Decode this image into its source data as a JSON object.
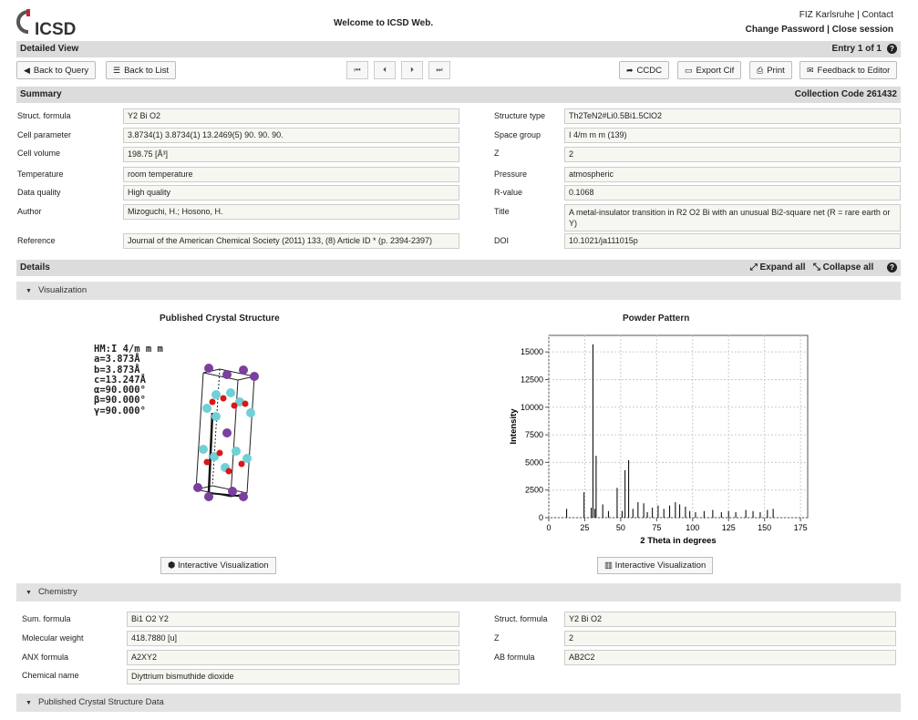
{
  "header": {
    "logo_text": "ICSD",
    "welcome": "Welcome to ICSD Web.",
    "fiz": "FIZ Karlsruhe",
    "contact": "Contact",
    "change_password": "Change Password",
    "close_session": "Close session"
  },
  "detailed_view": {
    "title": "Detailed View",
    "entry": "Entry 1 of 1"
  },
  "toolbar": {
    "back_query": "Back to Query",
    "back_list": "Back to List",
    "ccdc": "CCDC",
    "export_cif": "Export Cif",
    "print": "Print",
    "feedback": "Feedback to Editor"
  },
  "summary": {
    "title": "Summary",
    "collection": "Collection Code 261432",
    "left": [
      {
        "label": "Struct. formula",
        "value": "Y2 Bi O2"
      },
      {
        "label": "Cell parameter",
        "value": "3.8734(1) 3.8734(1) 13.2469(5) 90. 90. 90."
      },
      {
        "label": "Cell volume",
        "value": "198.75 [Å³]"
      },
      {
        "label": "Temperature",
        "value": "room temperature"
      },
      {
        "label": "Data quality",
        "value": "High quality"
      },
      {
        "label": "Author",
        "value": "Mizoguchi, H.; Hosono, H."
      },
      {
        "label": "Reference",
        "value": "Journal of the American Chemical Society (2011) 133, (8) Article ID * (p. 2394-2397)"
      }
    ],
    "right": [
      {
        "label": "Structure type",
        "value": "Th2TeN2#Li0.5Bi1.5ClO2"
      },
      {
        "label": "Space group",
        "value": "I 4/m m m   (139)"
      },
      {
        "label": "Z",
        "value": "2"
      },
      {
        "label": "Pressure",
        "value": "atmospheric"
      },
      {
        "label": "R-value",
        "value": "0.1068"
      },
      {
        "label": "Title",
        "value": "A metal-insulator transition in R2 O2 Bi with an unusual Bi2-square net (R = rare earth or Y)"
      },
      {
        "label": "DOI",
        "value": "10.1021/ja111015p"
      }
    ]
  },
  "details": {
    "title": "Details",
    "expand": "Expand all",
    "collapse": "Collapse all"
  },
  "visualization": {
    "section": "Visualization",
    "crystal_title": "Published Crystal Structure",
    "powder_title": "Powder Pattern",
    "interactive": "Interactive Visualization",
    "params": [
      "HM:I 4/m m m",
      "a=3.873Å",
      "b=3.873Å",
      "c=13.247Å",
      "α=90.000°",
      "β=90.000°",
      "γ=90.000°"
    ]
  },
  "chart_data": {
    "type": "bar",
    "xlabel": "2 Theta in degrees",
    "ylabel": "Intensity",
    "xlim": [
      0,
      180
    ],
    "ylim": [
      0,
      16500
    ],
    "grid": true,
    "xticks": [
      0,
      25,
      50,
      75,
      100,
      125,
      150,
      175
    ],
    "yticks": [
      0,
      2500,
      5000,
      7500,
      10000,
      12500,
      15000
    ],
    "x": [
      12.4,
      24.5,
      29.5,
      30.7,
      32.0,
      32.9,
      37.5,
      41.5,
      47.5,
      51.0,
      53.0,
      55.5,
      58.5,
      62.0,
      66.0,
      68.5,
      72.0,
      76.0,
      80.0,
      84.0,
      88.0,
      91.0,
      95.0,
      98.0,
      102.0,
      108.0,
      114.0,
      120.0,
      125.0,
      130.0,
      137.0,
      142.0,
      147.0,
      152.0,
      156.0
    ],
    "y": [
      800,
      2300,
      900,
      15700,
      800,
      5600,
      1200,
      600,
      2700,
      600,
      4300,
      5200,
      800,
      1400,
      1300,
      500,
      900,
      1100,
      800,
      1100,
      1400,
      1200,
      1000,
      600,
      500,
      600,
      700,
      500,
      600,
      500,
      700,
      600,
      500,
      700,
      800
    ]
  },
  "chemistry": {
    "section": "Chemistry",
    "left": [
      {
        "label": "Sum. formula",
        "value": "Bi1 O2 Y2"
      },
      {
        "label": "Molecular weight",
        "value": "418.7880 [u]"
      },
      {
        "label": "ANX formula",
        "value": "A2XY2"
      },
      {
        "label": "Chemical name",
        "value": "Diyttrium bismuthide dioxide"
      }
    ],
    "right": [
      {
        "label": "Struct. formula",
        "value": "Y2 Bi O2"
      },
      {
        "label": "Z",
        "value": "2"
      },
      {
        "label": "AB formula",
        "value": "AB2C2"
      }
    ]
  },
  "published": {
    "section": "Published Crystal Structure Data"
  }
}
